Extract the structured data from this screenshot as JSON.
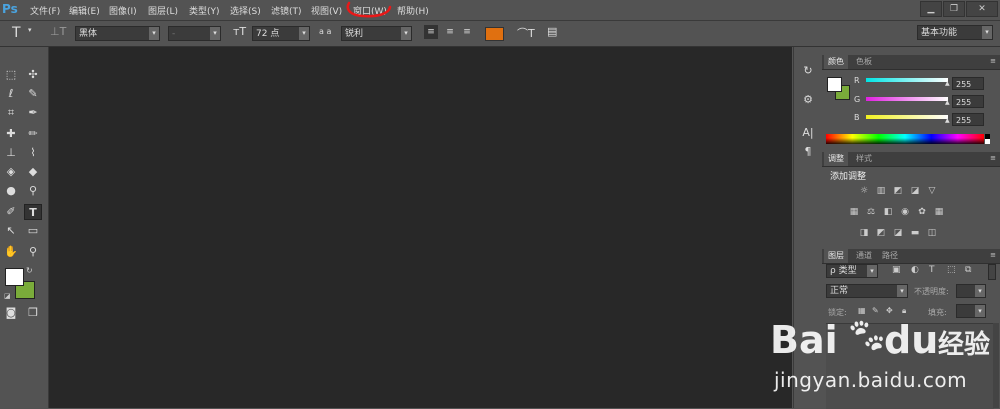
{
  "app": {
    "logo": "Ps"
  },
  "menu": [
    "文件(F)",
    "编辑(E)",
    "图像(I)",
    "图层(L)",
    "类型(Y)",
    "选择(S)",
    "滤镜(T)",
    "视图(V)",
    "窗口(W)",
    "帮助(H)"
  ],
  "options": {
    "tool_icon": "T",
    "font_family": "黑体",
    "font_style": "-",
    "font_size": "72 点",
    "aa_label": "a a",
    "aa_mode": "锐利",
    "text_color": "#e07010",
    "workspace": "基本功能"
  },
  "color_panel": {
    "tabs": [
      "颜色",
      "色板"
    ],
    "channels": [
      {
        "label": "R",
        "value": "255",
        "color": "#00e5e5"
      },
      {
        "label": "G",
        "value": "255",
        "color": "#e020e0"
      },
      {
        "label": "B",
        "value": "255",
        "color": "#f0f020"
      }
    ],
    "foreground": "#ffffff",
    "background": "#7aab3a"
  },
  "adjust_panel": {
    "tabs": [
      "调整",
      "样式"
    ],
    "title": "添加调整"
  },
  "layers_panel": {
    "tabs": [
      "图层",
      "通道",
      "路径"
    ],
    "filter_label": "ρ 类型",
    "blend_mode": "正常",
    "opacity_label": "不透明度:",
    "lock_label": "锁定:",
    "fill_label": "填充:"
  },
  "watermark": {
    "brand": "Bai",
    "brand2": "du",
    "brand_cn": "经验",
    "url": "jingyan.baidu.com"
  },
  "annotation": {
    "color": "#e81818"
  }
}
